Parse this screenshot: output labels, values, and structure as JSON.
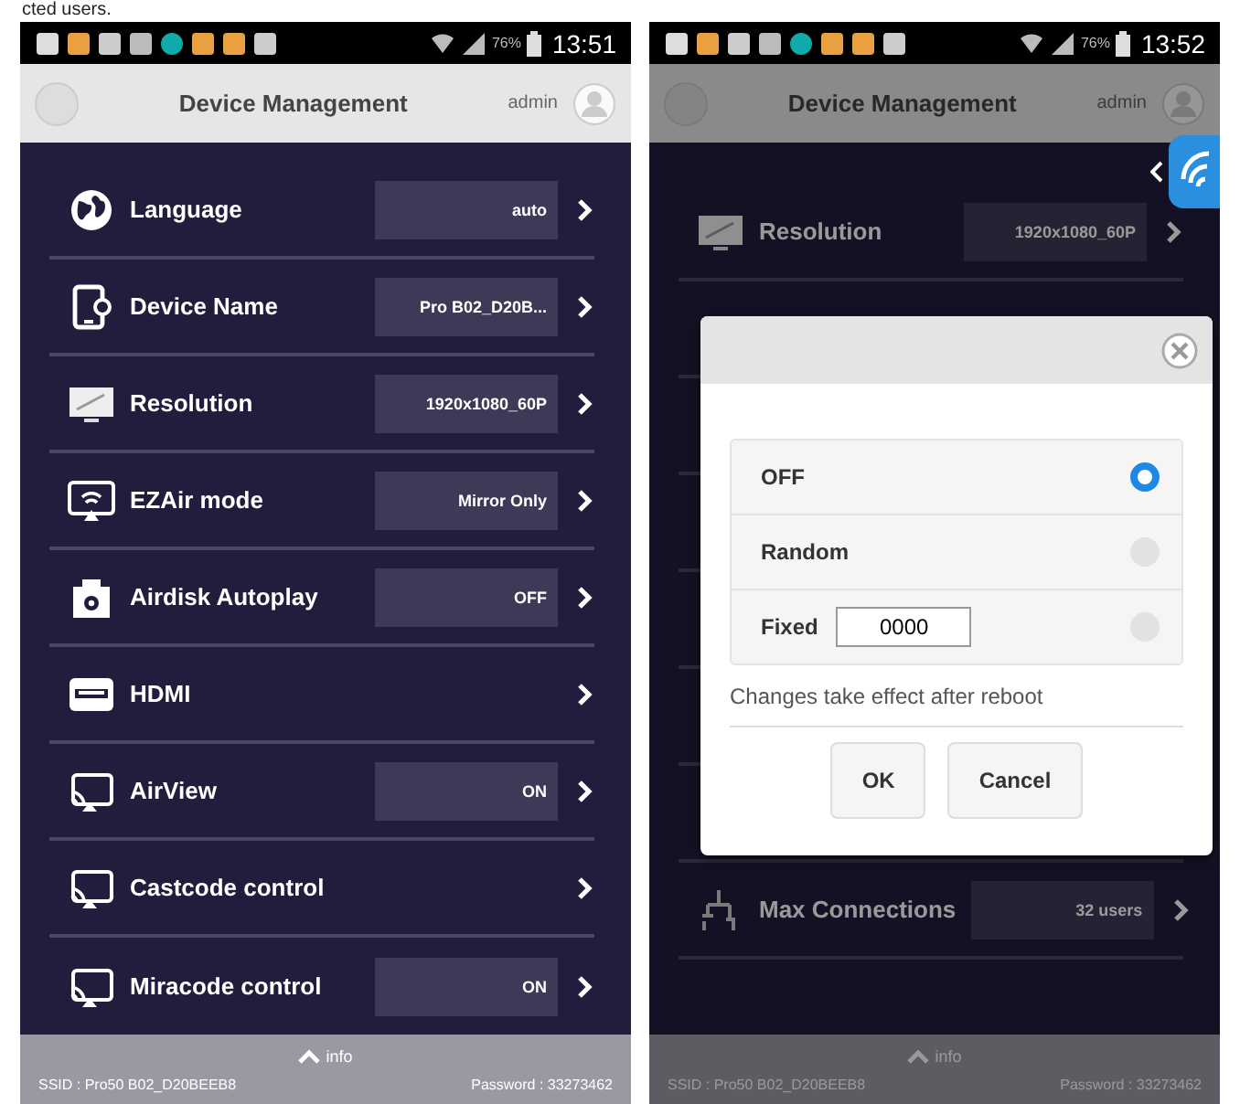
{
  "caption": "cted users.",
  "screens": [
    {
      "dimmed": false,
      "status_bar": {
        "battery": "76%",
        "time": "13:51"
      },
      "header": {
        "title": "Device Management",
        "user": "admin"
      },
      "rows": [
        {
          "kind": "globe",
          "label": "Language",
          "value": "auto"
        },
        {
          "kind": "tablet",
          "label": "Device Name",
          "value": "Pro B02_D20B..."
        },
        {
          "kind": "monitor",
          "label": "Resolution",
          "value": "1920x1080_60P"
        },
        {
          "kind": "cast",
          "label": "EZAir mode",
          "value": "Mirror Only"
        },
        {
          "kind": "camera",
          "label": "Airdisk Autoplay",
          "value": "OFF"
        },
        {
          "kind": "hdmi",
          "label": "HDMI"
        },
        {
          "kind": "mirror",
          "label": "AirView",
          "value": "ON"
        },
        {
          "kind": "mirror",
          "label": "Castcode control"
        },
        {
          "kind": "mirror",
          "label": "Miracode control",
          "value": "ON"
        }
      ],
      "footer": {
        "toggle": "info",
        "ssid": "SSID : Pro50 B02_D20BEEB8",
        "password": "Password : 33273462"
      }
    },
    {
      "dimmed": true,
      "status_bar": {
        "battery": "76%",
        "time": "13:52"
      },
      "header": {
        "title": "Device Management",
        "user": "admin"
      },
      "rows": [
        {
          "kind": "monitor",
          "label": "Resolution",
          "value": "1920x1080_60P"
        },
        {
          "kind": "hidden"
        },
        {
          "kind": "hidden"
        },
        {
          "kind": "hidden"
        },
        {
          "kind": "hidden"
        },
        {
          "kind": "hidden"
        },
        {
          "kind": "hidden"
        },
        {
          "kind": "hub",
          "label": "Max Connections",
          "value": "32 users"
        }
      ],
      "dialog": {
        "options": [
          {
            "label": "OFF",
            "selected": true
          },
          {
            "label": "Random",
            "selected": false
          },
          {
            "label": "Fixed",
            "selected": false,
            "value": "0000"
          }
        ],
        "note": "Changes take effect after reboot",
        "buttons": [
          "OK",
          "Cancel"
        ]
      },
      "footer": {
        "toggle": "info",
        "ssid": "SSID : Pro50 B02_D20BEEB8",
        "password": "Password : 33273462"
      }
    }
  ]
}
